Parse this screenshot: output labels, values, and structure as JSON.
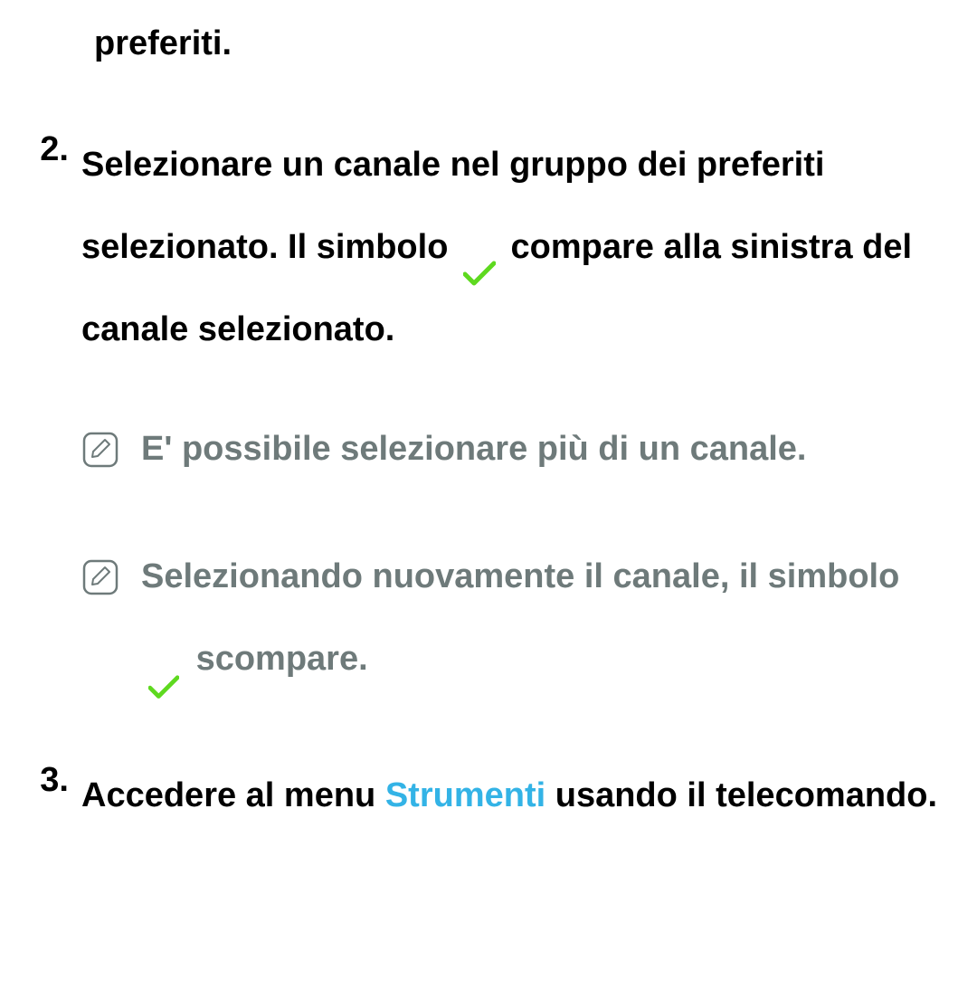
{
  "orphan_line": "preferiti.",
  "item2": {
    "number": "2.",
    "text_before_icon": "Selezionare un canale nel gruppo dei preferiti selezionato. Il simbolo",
    "text_after_icon": "compare alla sinistra del canale selezionato.",
    "notes": [
      {
        "text_full": "E' possibile selezionare più di un canale."
      },
      {
        "text_before_icon": "Selezionando nuovamente il canale, il simbolo",
        "text_after_icon": "scompare."
      }
    ]
  },
  "item3": {
    "number": "3.",
    "text_before_highlight": "Accedere al menu ",
    "highlight": "Strumenti",
    "text_after_highlight": " usando il telecomando."
  },
  "colors": {
    "check_green": "#5ed91f",
    "note_gray": "#6e7a7a",
    "highlight_blue": "#33b3e6"
  }
}
